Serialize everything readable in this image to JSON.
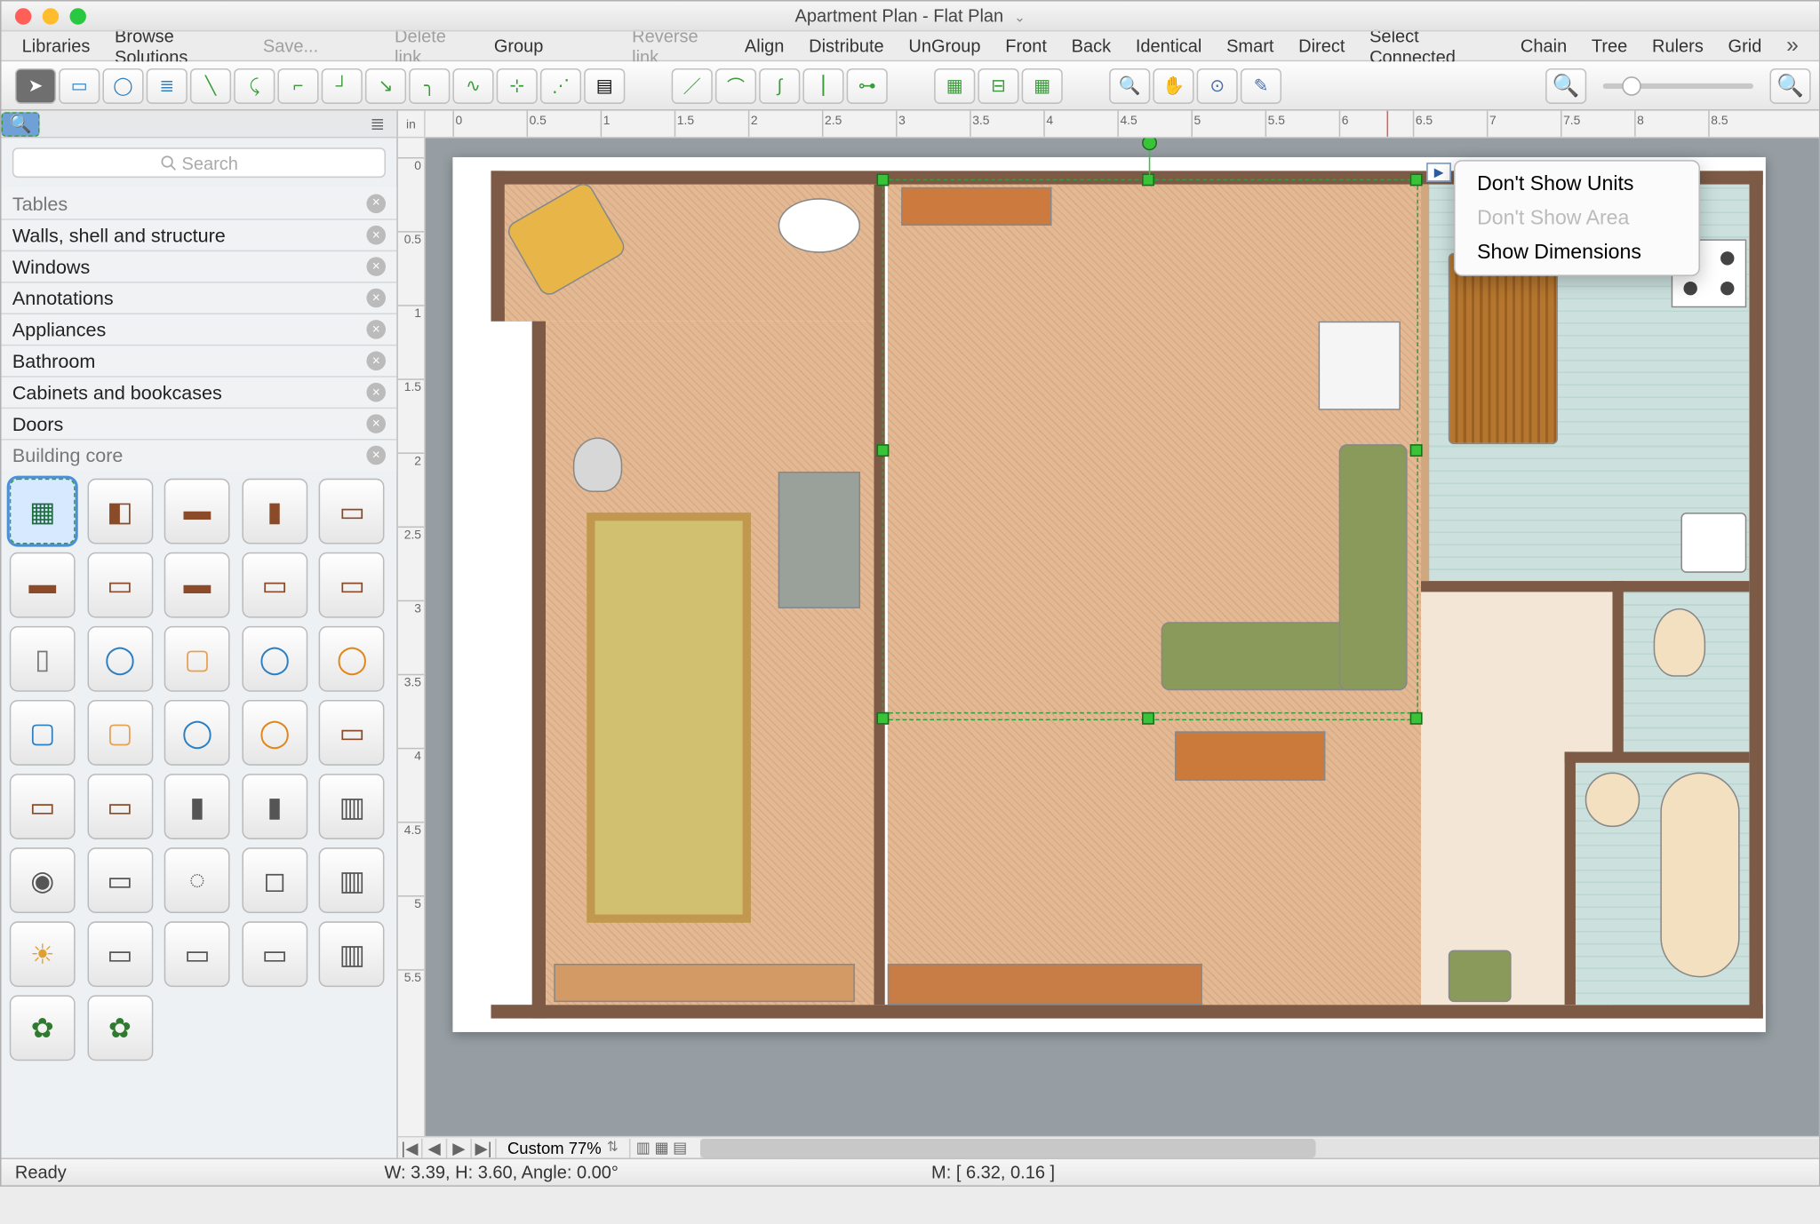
{
  "window": {
    "title": "Apartment Plan - Flat Plan"
  },
  "menubar": {
    "items": [
      "Libraries",
      "Browse Solutions",
      "Save...",
      "",
      "Delete link",
      "Group",
      "",
      "Reverse link",
      "Align",
      "Distribute",
      "UnGroup",
      "Front",
      "Back",
      "Identical",
      "Smart",
      "Direct",
      "Select Connected",
      "Chain",
      "Tree",
      "Rulers",
      "Grid"
    ],
    "dimmed": [
      "Save...",
      "Delete link",
      "Reverse link"
    ]
  },
  "toolbar": {
    "groups": [
      [
        "pointer",
        "rect",
        "ellipse",
        "text",
        "connector-straight",
        "connector-curve",
        "connector-round",
        "connector-right",
        "connector-smart",
        "connector-arc",
        "connector-spline",
        "connector-multi",
        "connector-free",
        "page"
      ],
      [
        "line-tool",
        "arc-tool",
        "spline-tool",
        "vertical-tool",
        "branch-tool"
      ],
      [
        "group-tool",
        "ungroup-tool",
        "align-tool"
      ],
      [
        "zoom-tool",
        "pan-tool",
        "stamp-tool",
        "eyedropper-tool"
      ]
    ],
    "glyphs": [
      "▶",
      "▭",
      "◯",
      "≣",
      "╲",
      "⤹",
      "⌐",
      "┘",
      "↘",
      "╮",
      "∿",
      "⊹",
      "⋰",
      "▤",
      "／",
      "⌒",
      "∫",
      "⎮",
      "⊶",
      "▦",
      "⊟",
      "▦",
      "🔍",
      "✋",
      "⊙",
      "✎"
    ]
  },
  "zoom": {
    "out": "−",
    "in": "+",
    "pos": 14
  },
  "ruler": {
    "unit": "in",
    "hticks": [
      0,
      0.5,
      1,
      1.5,
      2,
      2.5,
      3,
      3.5,
      4,
      4.5,
      5,
      5.5,
      6,
      6.5,
      7,
      7.5,
      8,
      8.5
    ],
    "vticks": [
      0,
      0.5,
      1,
      1.5,
      2,
      2.5,
      3,
      3.5,
      4,
      4.5,
      5,
      5.5
    ]
  },
  "leftpanel": {
    "search_placeholder": "Search",
    "categories_top": "Tables",
    "categories": [
      "Walls, shell and structure",
      "Windows",
      "Annotations",
      "Appliances",
      "Bathroom",
      "Cabinets and bookcases",
      "Doors",
      "Building core"
    ],
    "palette_count": 38,
    "palette_selected": 1
  },
  "context_menu": {
    "items": [
      "Don't Show Units",
      "Don't Show Area",
      "Show Dimensions"
    ],
    "dimmed": [
      "Don't Show Area"
    ]
  },
  "bottombar": {
    "zoom_label": "Custom 77%"
  },
  "status": {
    "left": "Ready",
    "mid": "W: 3.39,  H: 3.60,  Angle: 0.00°",
    "mouse": "M: [ 6.32, 0.16 ]"
  }
}
